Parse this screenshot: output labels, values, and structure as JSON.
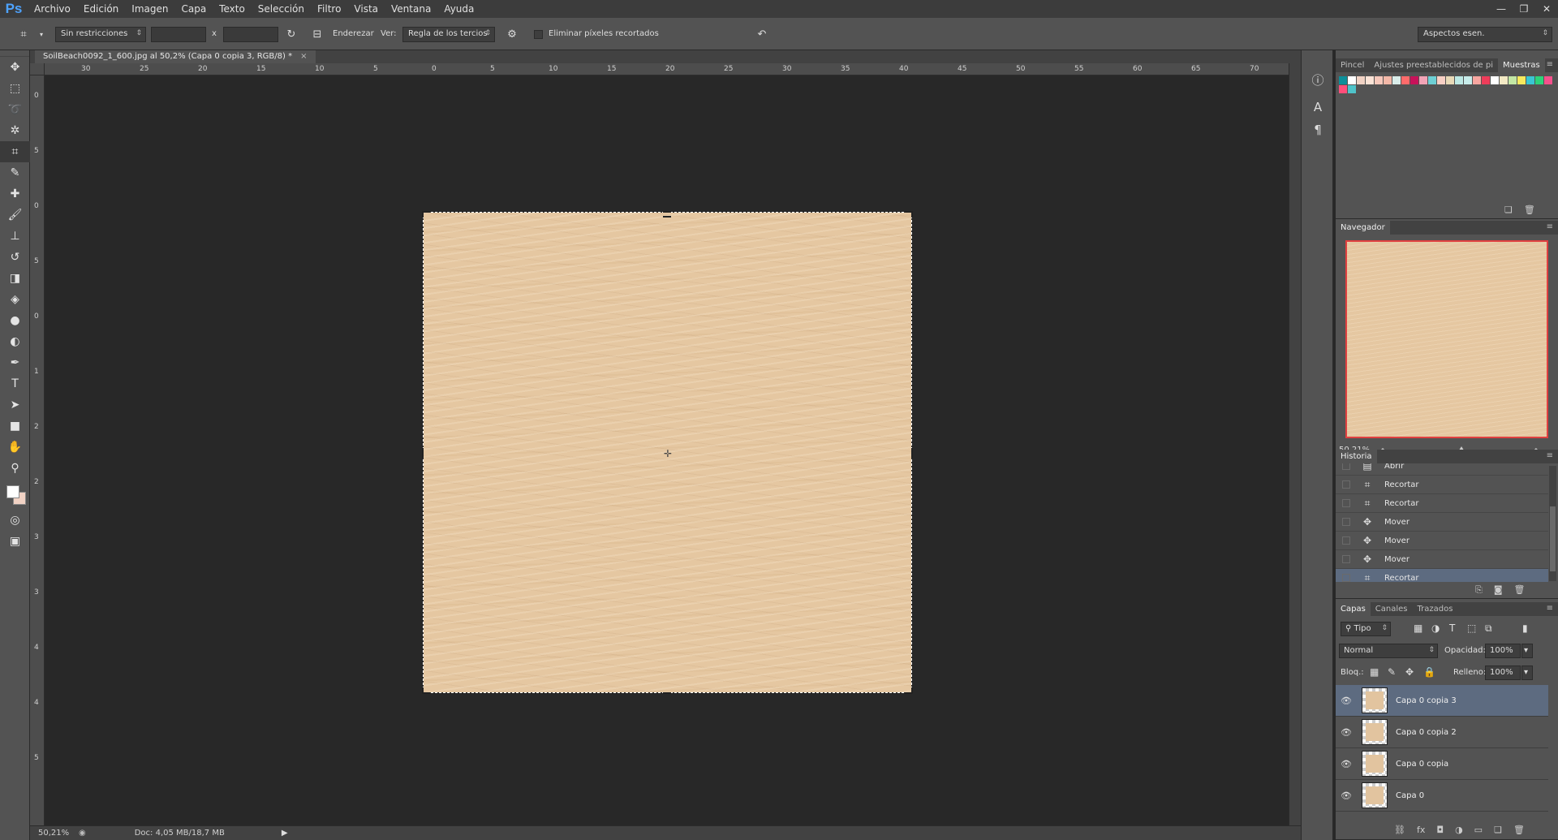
{
  "app": {
    "logo": "Ps",
    "menu": [
      "Archivo",
      "Edición",
      "Imagen",
      "Capa",
      "Texto",
      "Selección",
      "Filtro",
      "Vista",
      "Ventana",
      "Ayuda"
    ],
    "window_controls": [
      "—",
      "❐",
      "✕"
    ]
  },
  "options": {
    "ratio_select": "Sin restricciones",
    "x_sep": "x",
    "straighten_label": "Enderezar",
    "view_label": "Ver:",
    "view_select": "Regla de los tercios",
    "delete_pixels_label": "Eliminar píxeles recortados",
    "delete_pixels_checked": false,
    "workspace_select": "Aspectos esen."
  },
  "document": {
    "tab_title": "SoilBeach0092_1_600.jpg al 50,2% (Capa 0 copia 3, RGB/8) *",
    "close": "×"
  },
  "rulers": {
    "top": [
      "30",
      "25",
      "20",
      "15",
      "10",
      "5",
      "0",
      "5",
      "10",
      "15",
      "20",
      "25",
      "30",
      "35",
      "40",
      "45",
      "50",
      "55",
      "60",
      "65",
      "70"
    ],
    "left": [
      "0",
      "5",
      "0",
      "5",
      "0",
      "1",
      "2",
      "2",
      "3",
      "3",
      "4",
      "4",
      "5"
    ]
  },
  "status": {
    "zoom": "50,21%",
    "doc": "Doc: 4,05 MB/18,7 MB"
  },
  "panels": {
    "swatches": {
      "tabs": [
        "Pincel",
        "Ajustes preestablecidos de pi",
        "Muestras"
      ],
      "active_tab": "Muestras",
      "colors": [
        "#0d8f9a",
        "#ffffff",
        "#f1d2c4",
        "#fbe3d6",
        "#f6c8bb",
        "#f3b8a8",
        "#d9ece9",
        "#ff6b6b",
        "#c8125a",
        "#f2a4b6",
        "#6ecfd4",
        "#f7cfc4",
        "#e8d9b7",
        "#bde8e4",
        "#c7ecea",
        "#f7a6a0",
        "#ee3c5a",
        "#ffffff",
        "#f3e9c4",
        "#c3e7a4",
        "#f7e95e",
        "#39c6d3",
        "#2dd27a",
        "#f5508c",
        "#ff4e7a",
        "#4fc3c9"
      ]
    },
    "navigator": {
      "title": "Navegador",
      "zoom": "50,21%",
      "zoom_small_icon": "zoom-out",
      "zoom_large_icon": "zoom-in"
    },
    "history": {
      "title": "Historia",
      "items": [
        {
          "label": "Abrir",
          "icon": "document-icon"
        },
        {
          "label": "Recortar",
          "icon": "crop-icon"
        },
        {
          "label": "Recortar",
          "icon": "crop-icon"
        },
        {
          "label": "Mover",
          "icon": "move-icon"
        },
        {
          "label": "Mover",
          "icon": "move-icon"
        },
        {
          "label": "Mover",
          "icon": "move-icon"
        },
        {
          "label": "Recortar",
          "icon": "crop-icon",
          "selected": true
        }
      ]
    },
    "layers": {
      "tabs": [
        "Capas",
        "Canales",
        "Trazados"
      ],
      "active_tab": "Capas",
      "filter_select": "Tipo",
      "blend_mode": "Normal",
      "opacity_label": "Opacidad:",
      "opacity_value": "100%",
      "lock_label": "Bloq.:",
      "fill_label": "Relleno:",
      "fill_value": "100%",
      "items": [
        {
          "name": "Capa 0 copia 3",
          "selected": true
        },
        {
          "name": "Capa 0 copia 2",
          "selected": false
        },
        {
          "name": "Capa 0 copia",
          "selected": false
        },
        {
          "name": "Capa 0",
          "selected": false
        }
      ]
    }
  },
  "colors": {
    "foreground": "#ffffff",
    "background": "#f1d2c4",
    "sand": "#e5c7a1",
    "selection": "#5d6b80",
    "navigator_frame": "#e04040"
  }
}
